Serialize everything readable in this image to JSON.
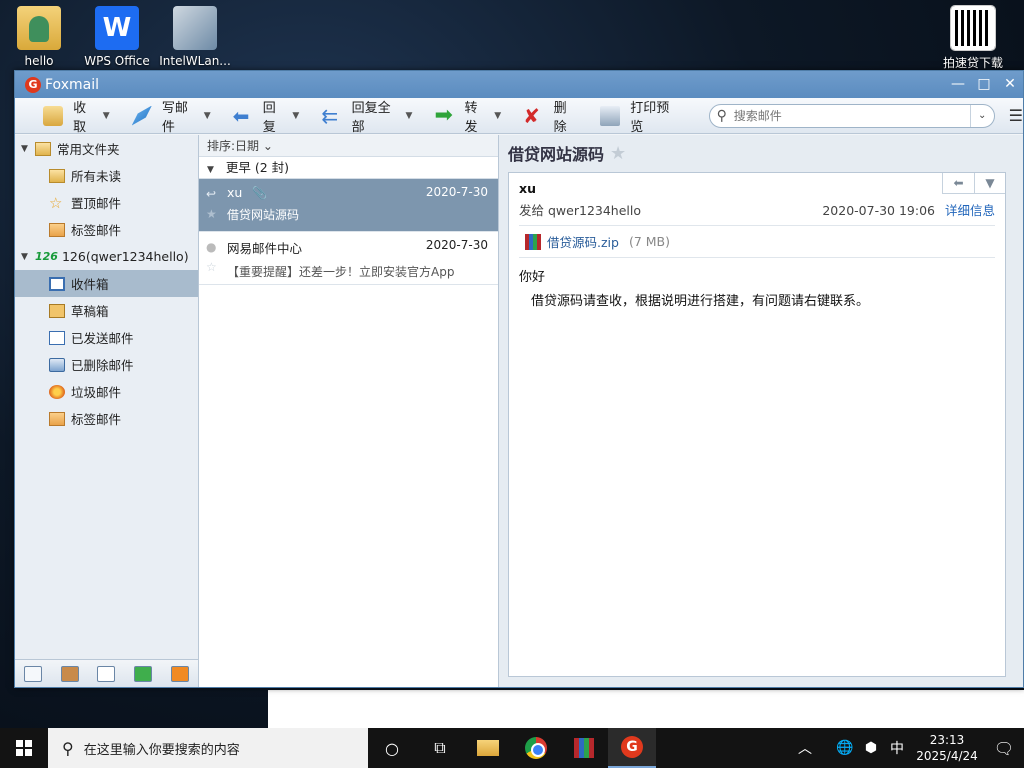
{
  "desktop": {
    "icons": [
      {
        "label": "hello"
      },
      {
        "label": "WPS Office"
      },
      {
        "label": "IntelWLan..."
      },
      {
        "label": "拍速贷下载"
      }
    ],
    "wps_glyph": "W"
  },
  "window": {
    "title": "Foxmail",
    "logo_glyph": "G",
    "controls": {
      "minimize": "—",
      "maximize": "□",
      "close": "✕"
    }
  },
  "toolbar": {
    "receive": "收取",
    "compose": "写邮件",
    "reply": "回复",
    "reply_all": "回复全部",
    "forward": "转发",
    "delete": "删除",
    "print_preview": "打印预览",
    "search_placeholder": "搜索邮件"
  },
  "folders": {
    "common_group": "常用文件夹",
    "common_items": [
      "所有未读",
      "置顶邮件",
      "标签邮件"
    ],
    "account_badge": "126",
    "account": "126(qwer1234hello)",
    "account_items": [
      "收件箱",
      "草稿箱",
      "已发送邮件",
      "已删除邮件",
      "垃圾邮件",
      "标签邮件"
    ]
  },
  "mail_list": {
    "sort_label": "排序:日期",
    "group_label": "更早 (2 封)",
    "items": [
      {
        "from": "xu",
        "date": "2020-7-30",
        "subject": "借贷网站源码"
      },
      {
        "from": "网易邮件中心",
        "date": "2020-7-30",
        "subject": "【重要提醒】还差一步！立即安装官方App"
      }
    ]
  },
  "preview": {
    "title": "借贷网站源码",
    "from": "xu",
    "to_prefix": "发给",
    "to": "qwer1234hello",
    "datetime": "2020-07-30 19:06",
    "details_link": "详细信息",
    "attachment_name": "借贷源码.zip",
    "attachment_size": "(7 MB)",
    "body_greeting": "你好",
    "body_text": "借贷源码请查收，根据说明进行搭建，有问题请右键联系。"
  },
  "taskbar": {
    "search_placeholder": "在这里输入你要搜索的内容",
    "ime": "中",
    "time": "23:13",
    "date": "2025/4/24"
  },
  "colors": {
    "accent": "#5b8cc0",
    "selected_row": "#7d96ae",
    "foxmail_red": "#e0391d"
  }
}
